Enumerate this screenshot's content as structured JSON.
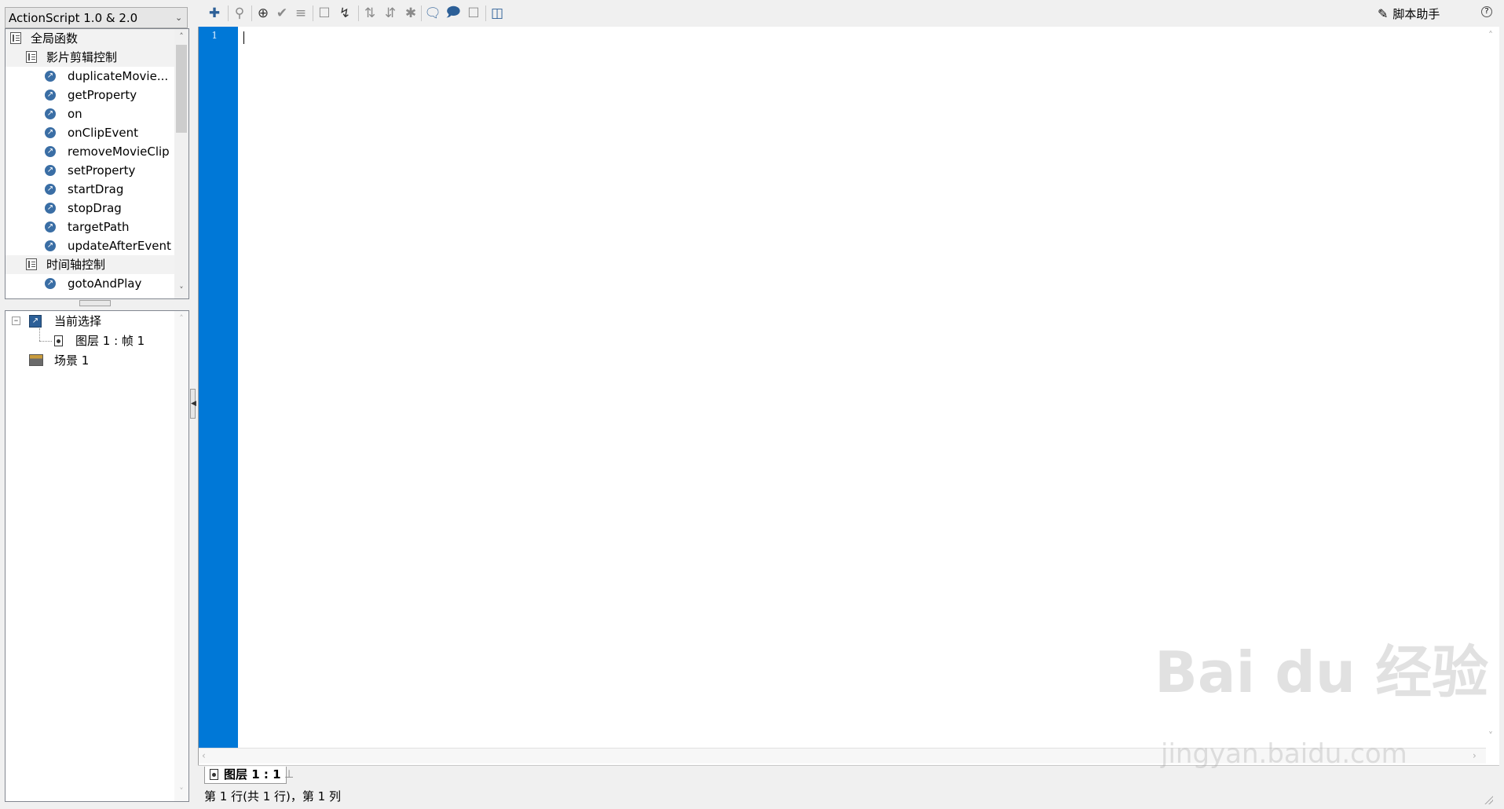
{
  "toolbox": {
    "language": "ActionScript 1.0 & 2.0",
    "items": [
      {
        "label": "全局函数",
        "kind": "category",
        "level": 0
      },
      {
        "label": "影片剪辑控制",
        "kind": "category",
        "level": 1
      },
      {
        "label": "duplicateMovie...",
        "kind": "function",
        "level": 2
      },
      {
        "label": "getProperty",
        "kind": "function",
        "level": 2
      },
      {
        "label": "on",
        "kind": "function",
        "level": 2
      },
      {
        "label": "onClipEvent",
        "kind": "function",
        "level": 2
      },
      {
        "label": "removeMovieClip",
        "kind": "function",
        "level": 2
      },
      {
        "label": "setProperty",
        "kind": "function",
        "level": 2
      },
      {
        "label": "startDrag",
        "kind": "function",
        "level": 2
      },
      {
        "label": "stopDrag",
        "kind": "function",
        "level": 2
      },
      {
        "label": "targetPath",
        "kind": "function",
        "level": 2
      },
      {
        "label": "updateAfterEvent",
        "kind": "function",
        "level": 2
      },
      {
        "label": "时间轴控制",
        "kind": "category",
        "level": 1
      },
      {
        "label": "gotoAndPlay",
        "kind": "function",
        "level": 2
      }
    ]
  },
  "navigator": {
    "current_selection": "当前选择",
    "frame": "图层 1 : 帧 1",
    "scene": "场景 1"
  },
  "toolbar": {
    "assistant_label": "脚本助手",
    "buttons": [
      "add-icon",
      "find-icon",
      "target-icon",
      "check-syntax-icon",
      "auto-format-icon",
      "code-hint-icon",
      "debug-icon",
      "collapse-braces-icon",
      "collapse-selection-icon",
      "expand-all-icon",
      "block-comment-icon",
      "line-comment-icon",
      "uncomment-icon",
      "panel-icon"
    ]
  },
  "editor": {
    "line_numbers": [
      "1"
    ],
    "gutter_color": "#0078d7"
  },
  "tab": {
    "label": "图层 1 : 1"
  },
  "status": {
    "text": "第 1 行(共 1 行)，第 1 列"
  },
  "watermark": {
    "brand": "Bai du 经验",
    "url": "jingyan.baidu.com"
  }
}
